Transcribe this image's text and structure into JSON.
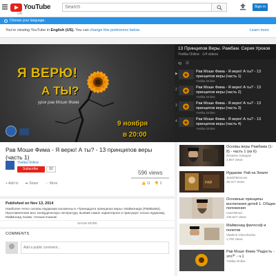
{
  "header": {
    "logo_text": "YouTube",
    "region": "UA",
    "search_placeholder": "Search",
    "signin_label": "Sign in"
  },
  "language_bar": {
    "label": "Choose your language."
  },
  "notice": {
    "text_prefix": "You're viewing YouTube in",
    "language": "English (US).",
    "text_mid": "You can",
    "link": "change this preference below.",
    "dismiss": "Learn more"
  },
  "player": {
    "title_line1": "Я ВЕРЮ!",
    "title_line2": "А ТЫ?",
    "subtitle": "урок рав Моше Фима",
    "date_line1": "9 ноября",
    "date_line2": "в 20:00"
  },
  "playlist": {
    "title": "13 Принципов Веры. Рамбам. Серия Уроков",
    "meta": "Yvelba Online · 1/4 videos",
    "items": [
      {
        "index": "▶",
        "title": "Рав Моше Фима - Я верю! А ты? - 13 принципов веры (часть 1)",
        "channel": "Yvelba Online"
      },
      {
        "index": "2",
        "title": "Рав Моше Фима - Я верю! А ты? - 13 принципов веры (часть 2)",
        "channel": "Yvelba Online"
      },
      {
        "index": "3",
        "title": "Рав Моше Фима - Я верю! А ты? - 13 принципов веры (часть 3)",
        "channel": "Yvelba Online"
      },
      {
        "index": "4",
        "title": "Рав Моше Фима - Я верю! А ты? - 13 принципов веры (часть 4)",
        "channel": "Yvelba Online"
      }
    ]
  },
  "video": {
    "title": "Рав Моше Фима - Я верю! А ты? - 13 принципов веры (часть 1)",
    "channel": "Yvelba Online",
    "subscribe_label": "Subscribe",
    "subscriber_count": "92",
    "views": "596 views",
    "actions": [
      "Add to",
      "Share",
      "More"
    ],
    "likes": "11",
    "dislikes": "3"
  },
  "description": {
    "published": "Published on Nov 13, 2014",
    "text": "Наиболее четко основы Иудаизма изложены в «Тринадцати принципах веры» Маймонида (РаМБаМа). Прославленная всю талмудическую литературу, выявив самое характерное и присущее только иудаизму, Маймонид лохим, точным языком",
    "show_more": "SHOW MORE"
  },
  "comments": {
    "heading": "COMMENTS",
    "placeholder": "Add a public comment..."
  },
  "recommendations": [
    {
      "title": "Основы веры Рамбама (1-8) - часть 1 (из 6)",
      "channel": "Йехиель Ковадзе",
      "views": "2,967 views",
      "duration": ""
    },
    {
      "title": "Иудаизм: Рай на Земле",
      "channel": "JewishMoscow",
      "views": "46,317 views",
      "duration": ""
    },
    {
      "title": "Основные принципы воспитания детей 1. Общие положения",
      "channel": "LearnMood",
      "views": "245,527 views",
      "duration": ""
    },
    {
      "title": "Маймонид философ и политик",
      "channel": "Vladimir Vdovchenko",
      "views": "1,792 views",
      "duration": ""
    },
    {
      "title": "Рав Моше Фима \"Радость - это?\" - ч.1",
      "channel": "Yvelba Online",
      "views": "",
      "duration": ""
    }
  ]
}
